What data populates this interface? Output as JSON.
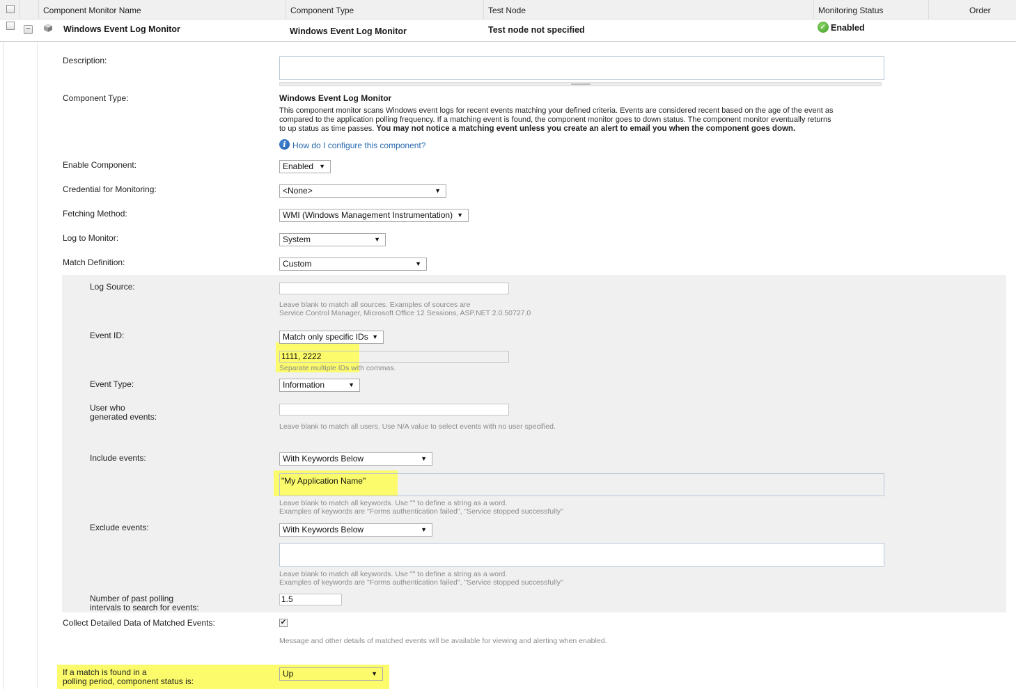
{
  "header": {
    "col_name": "Component Monitor Name",
    "col_type": "Component Type",
    "col_node": "Test Node",
    "col_status": "Monitoring Status",
    "col_order": "Order"
  },
  "row": {
    "name": "Windows Event Log Monitor",
    "type": "Windows Event Log Monitor",
    "node": "Test node not specified",
    "status": "Enabled",
    "status_color": "#3f9d22"
  },
  "form": {
    "description_label": "Description:",
    "description_value": "",
    "component_type_label": "Component Type:",
    "component_type_title": "Windows Event Log Monitor",
    "component_type_desc1": "This component monitor scans Windows event logs for recent events matching your defined criteria. Events are considered recent based on the age of the event as",
    "component_type_desc2": "compared to the application polling frequency. If a matching event is found, the component monitor goes to down status. The component monitor eventually returns",
    "component_type_desc3a": "to up status as time passes. ",
    "component_type_desc3b": "You may not notice a matching event unless you create an alert to email you when the component goes down.",
    "help_link": "How do I configure this component?",
    "enable_label": "Enable Component:",
    "enable_value": "Enabled",
    "credential_label": "Credential for Monitoring:",
    "credential_value": "<None>",
    "fetching_label": "Fetching Method:",
    "fetching_value": "WMI (Windows Management Instrumentation)",
    "log_label": "Log to Monitor:",
    "log_value": "System",
    "match_label": "Match Definition:",
    "match_value": "Custom",
    "log_source_label": "Log Source:",
    "log_source_value": "",
    "log_source_hint1": "Leave blank to match all sources. Examples of sources are",
    "log_source_hint2": "Service Control Manager, Microsoft Office 12 Sessions, ASP.NET 2.0.50727.0",
    "event_id_label": "Event ID:",
    "event_id_mode": "Match only specific IDs",
    "event_id_value": "1111, 2222",
    "event_id_hint": "Separate multiple IDs with commas.",
    "event_type_label": "Event Type:",
    "event_type_value": "Information",
    "user_label1": "User who",
    "user_label2": "generated events:",
    "user_value": "",
    "user_hint": "Leave blank to match all users. Use N/A value to select events with no user specified.",
    "include_label": "Include events:",
    "include_mode": "With Keywords Below",
    "include_value": "\"My Application Name\"",
    "keywords_hint1": "Leave blank to match all keywords. Use \"\" to define a string as a word.",
    "keywords_hint2": "Examples of keywords are \"Forms authentication failed\", \"Service stopped successfully\"",
    "exclude_label": "Exclude events:",
    "exclude_mode": "With Keywords Below",
    "exclude_value": "",
    "intervals_label1": "Number of past polling",
    "intervals_label2": "intervals to search for events:",
    "intervals_value": "1.5",
    "collect_label": "Collect Detailed Data of Matched Events:",
    "collect_checked": true,
    "collect_hint": "Message and other details of matched events will be available for viewing and alerting when enabled.",
    "match_status_label1": "If a match is found in a",
    "match_status_label2": "polling period, component status is:",
    "match_status_value": "Up"
  },
  "colors": {
    "highlight": "#fbfb6b",
    "link": "#2a6ab0",
    "gray_zone": "#f0f0f0"
  }
}
